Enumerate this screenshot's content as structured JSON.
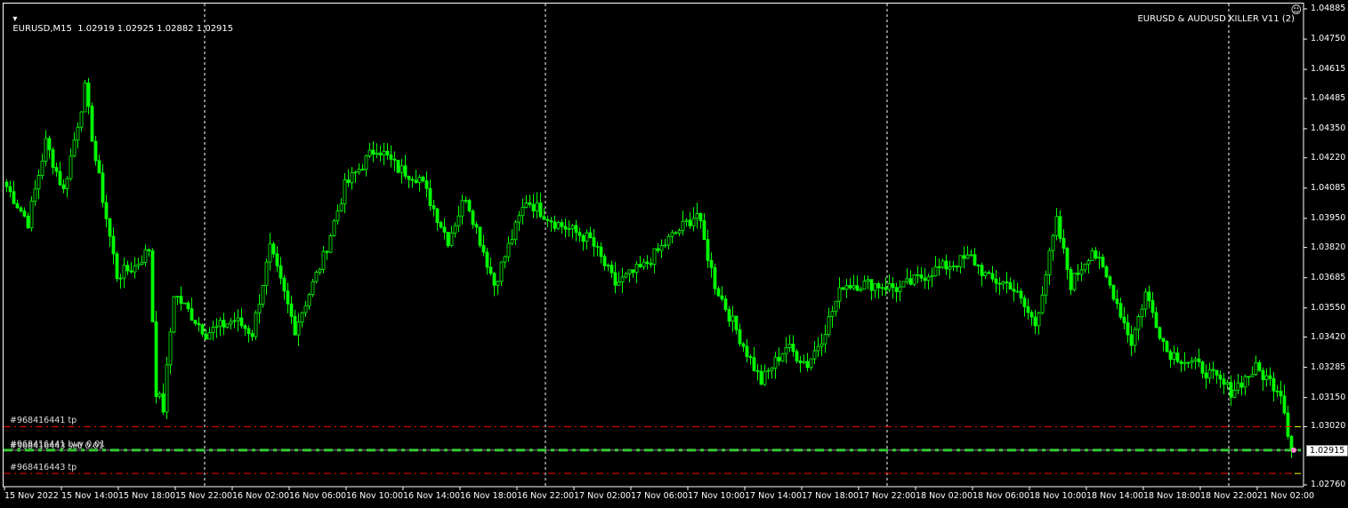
{
  "header": {
    "symbol_line": "EURUSD,M15  1.02919 1.02925 1.02882 1.02915",
    "expert_label": "EURUSD & AUDUSD KILLER V11 (2)",
    "expert_icon": "smiley-icon"
  },
  "price_axis": [
    "1.04885",
    "1.04750",
    "1.04615",
    "1.04485",
    "1.04350",
    "1.04220",
    "1.04085",
    "1.03950",
    "1.03820",
    "1.03685",
    "1.03550",
    "1.03420",
    "1.03285",
    "1.03150",
    "1.03020",
    "1.02760"
  ],
  "current_price": "1.02915",
  "time_axis": [
    "15 Nov 2022",
    "15 Nov 14:00",
    "15 Nov 18:00",
    "15 Nov 22:00",
    "16 Nov 02:00",
    "16 Nov 06:00",
    "16 Nov 10:00",
    "16 Nov 14:00",
    "16 Nov 18:00",
    "16 Nov 22:00",
    "17 Nov 02:00",
    "17 Nov 06:00",
    "17 Nov 10:00",
    "17 Nov 14:00",
    "17 Nov 18:00",
    "17 Nov 22:00",
    "18 Nov 02:00",
    "18 Nov 06:00",
    "18 Nov 10:00",
    "18 Nov 14:00",
    "18 Nov 18:00",
    "18 Nov 22:00",
    "21 Nov 02:00"
  ],
  "order_lines": [
    {
      "label": "#968416441 tp",
      "price": 1.0302,
      "color": "#ff0000"
    },
    {
      "label": "#968416441 buy 0.01",
      "price": 1.02915,
      "color": "#33cc33"
    },
    {
      "label": "#968416443 sell 0.01",
      "price": 1.02915,
      "color": "#33cc33"
    },
    {
      "label": "#968416443 tp",
      "price": 1.02811,
      "color": "#ff0000"
    }
  ],
  "chart_data": {
    "type": "candlestick",
    "symbol": "EURUSD",
    "timeframe": "M15",
    "ylim": [
      1.0276,
      1.04885
    ],
    "candle_count": 362,
    "bull_color": "#00ff00",
    "anchors": [
      [
        0,
        1.04092
      ],
      [
        6,
        1.03933
      ],
      [
        11,
        1.0429
      ],
      [
        16,
        1.04072
      ],
      [
        22,
        1.04528
      ],
      [
        25,
        1.04211
      ],
      [
        31,
        1.03695
      ],
      [
        36,
        1.03735
      ],
      [
        40,
        1.03814
      ],
      [
        42,
        1.0318
      ],
      [
        44,
        1.03101
      ],
      [
        47,
        1.03616
      ],
      [
        51,
        1.03537
      ],
      [
        56,
        1.03438
      ],
      [
        64,
        1.03497
      ],
      [
        69,
        1.03438
      ],
      [
        74,
        1.03814
      ],
      [
        81,
        1.03458
      ],
      [
        89,
        1.03775
      ],
      [
        95,
        1.04092
      ],
      [
        104,
        1.0427
      ],
      [
        110,
        1.04171
      ],
      [
        116,
        1.04132
      ],
      [
        124,
        1.03854
      ],
      [
        129,
        1.04052
      ],
      [
        137,
        1.03656
      ],
      [
        146,
        1.04033
      ],
      [
        154,
        1.03933
      ],
      [
        164,
        1.03854
      ],
      [
        171,
        1.03656
      ],
      [
        179,
        1.03735
      ],
      [
        186,
        1.03854
      ],
      [
        194,
        1.03973
      ],
      [
        199,
        1.03656
      ],
      [
        206,
        1.03418
      ],
      [
        212,
        1.0322
      ],
      [
        219,
        1.03378
      ],
      [
        225,
        1.03299
      ],
      [
        229,
        1.03418
      ],
      [
        235,
        1.03656
      ],
      [
        244,
        1.03656
      ],
      [
        251,
        1.03636
      ],
      [
        260,
        1.03715
      ],
      [
        271,
        1.03775
      ],
      [
        276,
        1.03676
      ],
      [
        282,
        1.03656
      ],
      [
        289,
        1.03477
      ],
      [
        295,
        1.03933
      ],
      [
        299,
        1.03656
      ],
      [
        305,
        1.03814
      ],
      [
        311,
        1.03616
      ],
      [
        316,
        1.03398
      ],
      [
        320,
        1.03616
      ],
      [
        326,
        1.03358
      ],
      [
        336,
        1.03279
      ],
      [
        344,
        1.0318
      ],
      [
        351,
        1.03279
      ],
      [
        358,
        1.0318
      ],
      [
        361,
        1.02915
      ]
    ]
  }
}
